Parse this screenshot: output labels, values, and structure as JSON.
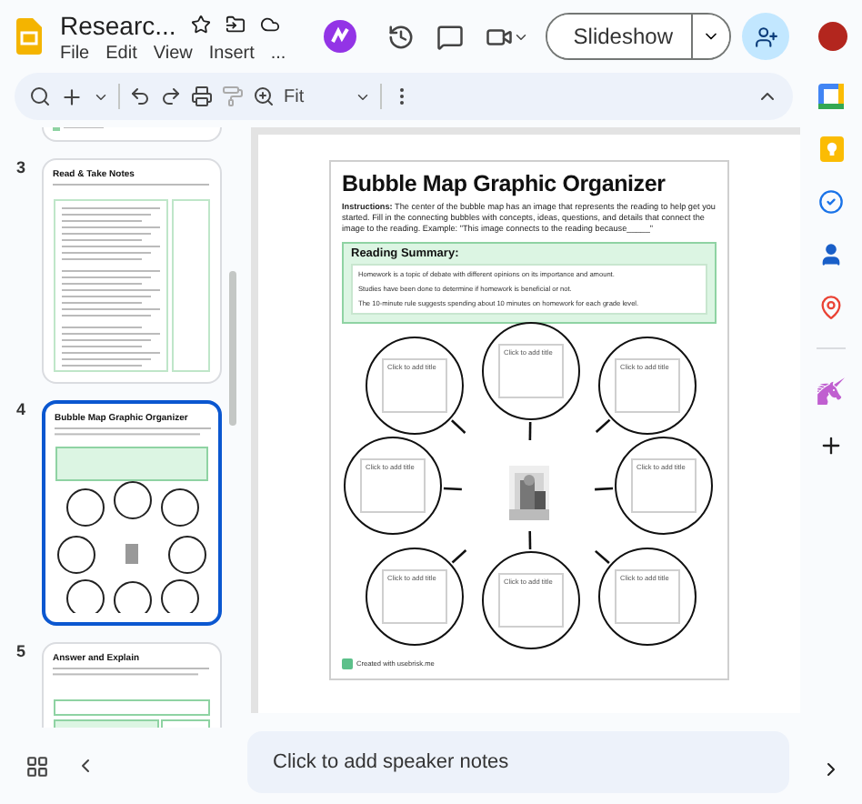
{
  "app": {
    "doc_title": "Researc...",
    "menu": [
      "File",
      "Edit",
      "View",
      "Insert",
      "..."
    ],
    "slideshow_button": "Slideshow"
  },
  "toolbar": {
    "zoom": "Fit"
  },
  "filmstrip": [
    {
      "number": "3",
      "title": "Read & Take Notes",
      "kind": "notes",
      "selected": false
    },
    {
      "number": "4",
      "title": "Bubble Map Graphic Organizer",
      "kind": "bubble",
      "selected": true
    },
    {
      "number": "5",
      "title": "Answer and Explain",
      "kind": "answer",
      "selected": false
    }
  ],
  "slide": {
    "title": "Bubble Map Graphic Organizer",
    "instructions": "**Instructions:** The center of the bubble map has an image that represents the reading to help get you started. Fill in the connecting bubbles with concepts, ideas, questions, and details that connect the image to the reading. Example: \"This image connects to the reading because_____\"",
    "summary": {
      "heading": "Reading Summary:",
      "lines": [
        "Homework is a topic of debate with different opinions on its importance and amount.",
        "Studies have been done to determine if homework is beneficial or not.",
        "The 10-minute rule suggests spending about 10 minutes on homework for each grade level."
      ]
    },
    "bubbles": [
      {
        "placeholder": "Click to add title"
      },
      {
        "placeholder": "Click to add title"
      },
      {
        "placeholder": "Click to add title"
      },
      {
        "placeholder": "Click to add title"
      },
      {
        "placeholder": "Click to add title"
      },
      {
        "placeholder": "Click to add title"
      },
      {
        "placeholder": "Click to add title"
      },
      {
        "placeholder": "Click to add title"
      }
    ],
    "footer": "Created with usebrisk.me"
  },
  "speaker_notes": {
    "placeholder": "Click to add speaker notes"
  }
}
